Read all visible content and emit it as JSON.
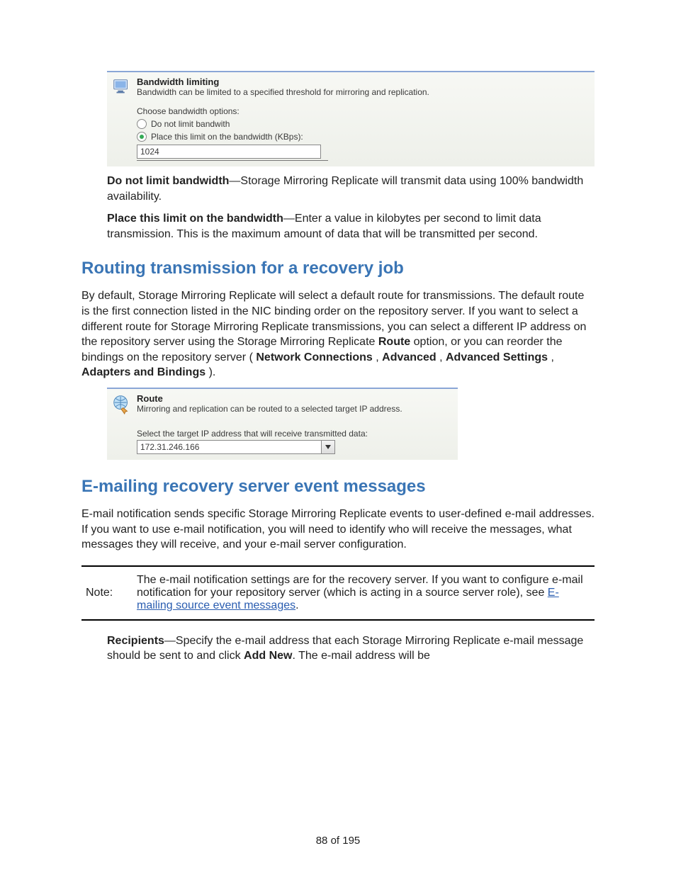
{
  "panel1": {
    "icon": "monitor-icon",
    "title": "Bandwidth limiting",
    "desc": "Bandwidth can be limited to a specified threshold for mirroring and replication.",
    "choose_label": "Choose bandwidth options:",
    "option1": "Do not limit bandwith",
    "option2": "Place this limit on the bandwidth (KBps):",
    "value": "1024"
  },
  "para1": {
    "bold": "Do not limit bandwidth",
    "text": "—Storage Mirroring Replicate will transmit data using 100% bandwidth availability."
  },
  "para2": {
    "bold": "Place this limit on the bandwidth",
    "text": "—Enter a value in kilobytes per second to limit data transmission. This is the maximum amount of data that will be transmitted per second."
  },
  "heading1": "Routing transmission for a recovery job",
  "routing_para_parts": {
    "p1": "By default, Storage Mirroring Replicate will select a default route for transmissions. The default route is the first connection listed in the NIC binding order on the repository server. If you want to select a different route for Storage Mirroring Replicate transmissions, you can select a different IP address on the repository server using the Storage Mirroring Replicate ",
    "b1": "Route",
    "p2": " option, or you can reorder the bindings on the repository server (",
    "b2": "Network Connections",
    "c1": ", ",
    "b3": "Advanced",
    "c2": ", ",
    "b4": "Advanced Settings",
    "c3": ", ",
    "b5": "Adapters and Bindings",
    "p3": ")."
  },
  "panel2": {
    "icon": "globe-icon",
    "title": "Route",
    "desc": "Mirroring and replication can be routed to a selected target IP address.",
    "select_label": "Select the target IP address that will receive transmitted data:",
    "value": "172.31.246.166"
  },
  "heading2": "E-mailing recovery server event messages",
  "email_para": "E-mail notification sends specific Storage Mirroring Replicate events to user-defined e-mail addresses. If you want to use e-mail notification, you will need to identify who will receive the messages, what messages they will receive, and your e-mail server configuration.",
  "note": {
    "label": "Note:",
    "text1": "The e-mail notification settings are for the recovery server. If you want to configure e-mail notification for your repository server (which is acting in a source server role), see ",
    "link": "E-mailing source event messages",
    "text2": "."
  },
  "recipients": {
    "bold": "Recipients",
    "text1": "—Specify the e-mail address that each Storage Mirroring Replicate e-mail message should be sent to and click ",
    "bold2": "Add New",
    "text2": ". The e-mail address will be"
  },
  "footer": "88 of 195"
}
